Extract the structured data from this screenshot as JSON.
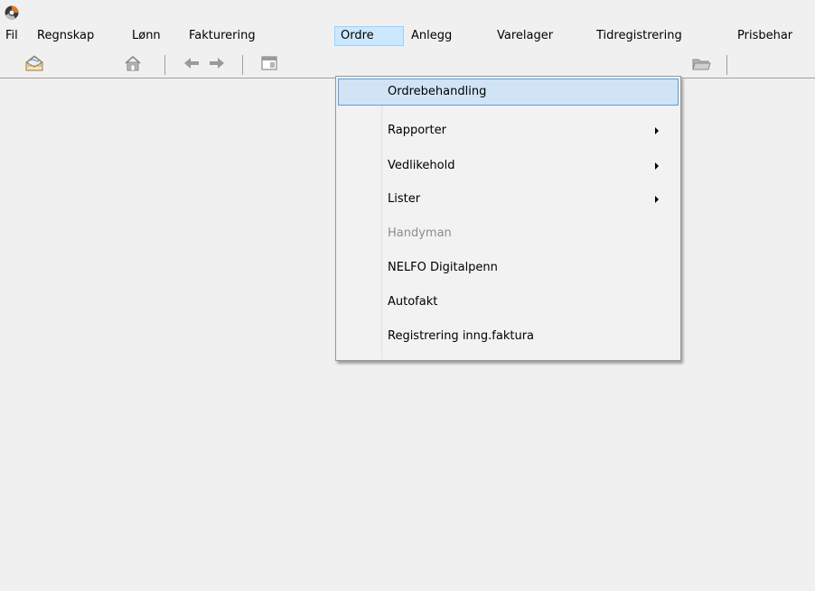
{
  "app": {
    "icon": "app-logo-icon"
  },
  "menubar": {
    "items": [
      {
        "label": "Fil"
      },
      {
        "label": "Regnskap"
      },
      {
        "label": "Lønn"
      },
      {
        "label": "Fakturering"
      },
      {
        "label": "Ordre",
        "active": true
      },
      {
        "label": "Anlegg"
      },
      {
        "label": "Varelager"
      },
      {
        "label": "Tidregistrering"
      },
      {
        "label": "Prisbehar"
      }
    ]
  },
  "toolbar": {
    "icons": [
      "mail-icon",
      "home-icon",
      "back-arrow-icon",
      "forward-arrow-icon",
      "window-icon",
      "folder-icon"
    ]
  },
  "ordre_menu": {
    "items": [
      {
        "label": "Ordrebehandling",
        "highlighted": true
      },
      {
        "label": "Rapporter",
        "submenu": true
      },
      {
        "label": "Vedlikehold",
        "submenu": true
      },
      {
        "label": "Lister",
        "submenu": true
      },
      {
        "label": "Handyman",
        "disabled": true
      },
      {
        "label": "NELFO Digitalpenn"
      },
      {
        "label": "Autofakt"
      },
      {
        "label": "Registrering inng.faktura"
      }
    ]
  },
  "colors": {
    "background": "#f0f0f0",
    "menu_active_bg": "#cce8ff",
    "menu_active_border": "#99d1ff",
    "dropdown_highlight_bg": "#d1e4f6",
    "dropdown_highlight_border": "#5b9fd8",
    "disabled_text": "#8c8c8c"
  }
}
